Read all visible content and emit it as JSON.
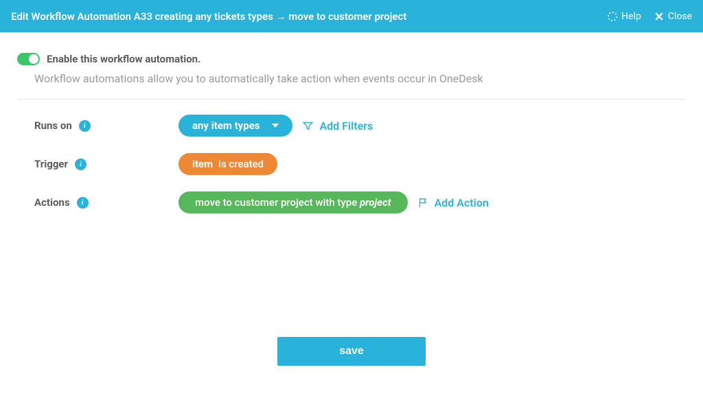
{
  "header": {
    "title": "Edit Workflow Automation A33 creating any tickets types → move to customer project",
    "help_label": "Help",
    "close_label": "Close"
  },
  "toggle": {
    "label": "Enable this workflow automation."
  },
  "description": "Workflow automations allow you to automatically take action when events occur in OneDesk",
  "rows": {
    "runs_on": {
      "label": "Runs on",
      "pill": "any item types",
      "add": "Add Filters"
    },
    "trigger": {
      "label": "Trigger",
      "pill_bold": "item",
      "pill_rest": " is created"
    },
    "actions": {
      "label": "Actions",
      "pill_pre": "move to customer project with type  ",
      "pill_italic": "project",
      "add": "Add Action"
    }
  },
  "save": "save",
  "colors": {
    "primary": "#29b3da",
    "green": "#56b85b",
    "orange": "#ef8834",
    "toggle_on": "#3bc768"
  }
}
